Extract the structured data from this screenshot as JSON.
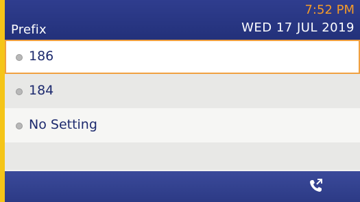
{
  "header": {
    "title": "Prefix",
    "time": "7:52 PM",
    "date": "WED 17 JUL 2019"
  },
  "list": {
    "items": [
      {
        "label": "186",
        "selected": true
      },
      {
        "label": "184",
        "selected": false
      },
      {
        "label": "No Setting",
        "selected": false
      }
    ]
  },
  "footer": {
    "icon": "call-transfer-icon"
  },
  "colors": {
    "header_bg": "#23317a",
    "accent_time": "#f39a2a",
    "selection_border": "#f0a040",
    "text": "#1d2a6e",
    "frame": "#f5c518"
  }
}
